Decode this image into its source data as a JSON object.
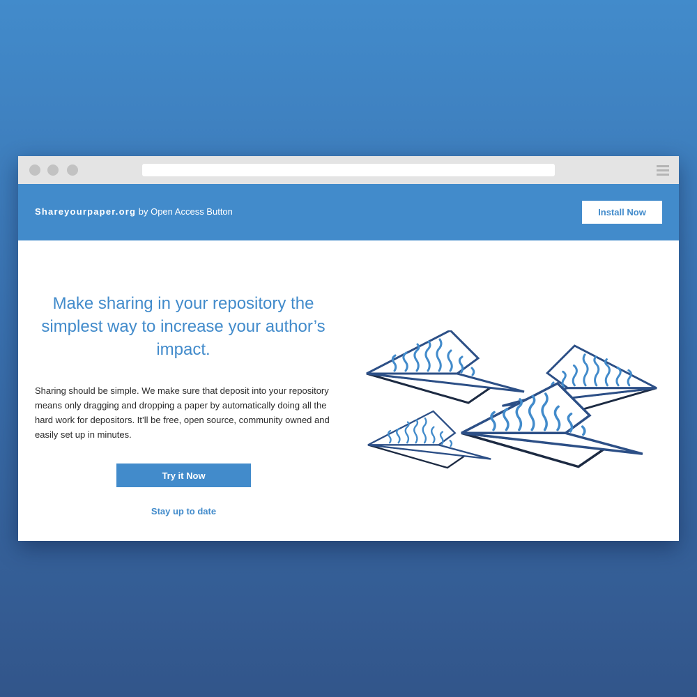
{
  "browser": {
    "window_controls": [
      "close",
      "minimize",
      "maximize"
    ],
    "menu_icon": "hamburger-menu-icon"
  },
  "navbar": {
    "brand_name": "Shareyourpaper.org",
    "brand_suffix": " by Open Access Button",
    "install_label": "Install Now"
  },
  "hero": {
    "headline": "Make sharing in your repository the simplest way to increase your author’s impact.",
    "description": "Sharing should be simple. We make sure that deposit into your repository means only dragging and dropping a paper by automatically doing all the hard work for depositors. It’ll be free, open source, community owned and easily set up in minutes.",
    "cta_label": "Try it Now",
    "secondary_link": "Stay up to date"
  },
  "illustration": {
    "name": "paper-planes-illustration",
    "count": 4
  },
  "colors": {
    "background_top": "#428bcb",
    "background_bottom": "#32558a",
    "accent": "#428bcb",
    "plane_outline": "#2c4f86",
    "plane_shadow": "#1c2a42",
    "chrome": "#e4e4e4"
  }
}
